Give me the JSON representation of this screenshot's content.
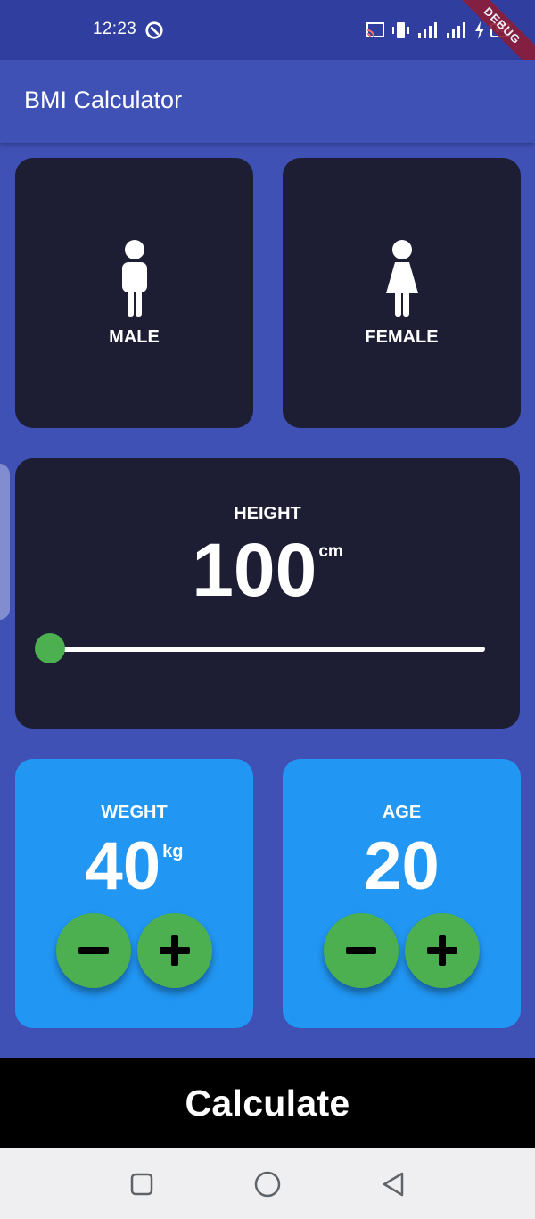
{
  "status_bar": {
    "time": "12:23",
    "battery": "99",
    "icons": [
      "at-sign-icon",
      "cast-icon",
      "vibrate-icon",
      "signal-icon",
      "signal-icon",
      "charging-icon",
      "battery-icon"
    ]
  },
  "debug_banner": "DEBUG",
  "app_bar": {
    "title": "BMI Calculator"
  },
  "gender": {
    "male_label": "MALE",
    "female_label": "FEMALE"
  },
  "height": {
    "label": "HEIGHT",
    "value": "100",
    "unit": "cm",
    "slider_level": 0.0
  },
  "weight": {
    "label": "WEGHT",
    "value": "40",
    "unit": "kg"
  },
  "age": {
    "label": "AGE",
    "value": "20"
  },
  "calculate_label": "Calculate",
  "colors": {
    "background": "#3f51b5",
    "status_bar": "#303f9f",
    "card_dark": "#1d1e33",
    "card_blue": "#2196f3",
    "accent_green": "#4caf50",
    "calculate_bar": "#000000"
  }
}
